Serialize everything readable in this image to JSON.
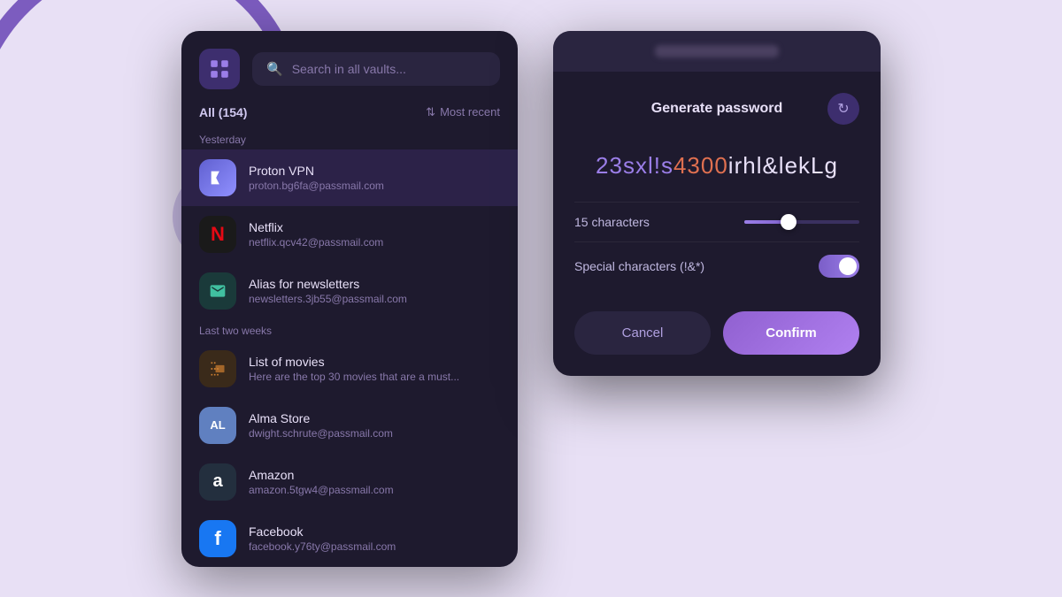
{
  "background": {
    "color": "#e8e0f5"
  },
  "vault_panel": {
    "logo_icon": "grid-icon",
    "search_placeholder": "Search in all vaults...",
    "filter": {
      "label": "All",
      "count": "(154)",
      "sort": "Most recent"
    },
    "sections": [
      {
        "label": "Yesterday",
        "items": [
          {
            "name": "Proton VPN",
            "email": "proton.bg6fa@passmail.com",
            "icon_type": "proton"
          },
          {
            "name": "Netflix",
            "email": "netflix.qcv42@passmail.com",
            "icon_type": "netflix"
          },
          {
            "name": "Alias for newsletters",
            "email": "newsletters.3jb55@passmail.com",
            "icon_type": "alias"
          }
        ]
      },
      {
        "label": "Last two weeks",
        "items": [
          {
            "name": "List of movies",
            "email": "Here are the top 30 movies that are a must...",
            "icon_type": "movies"
          },
          {
            "name": "Alma Store",
            "email": "dwight.schrute@passmail.com",
            "icon_type": "alma",
            "initials": "AL"
          },
          {
            "name": "Amazon",
            "email": "amazon.5tgw4@passmail.com",
            "icon_type": "amazon",
            "symbol": "a"
          },
          {
            "name": "Facebook",
            "email": "facebook.y76ty@passmail.com",
            "icon_type": "facebook",
            "symbol": "f"
          }
        ]
      }
    ]
  },
  "password_panel": {
    "title": "Generate password",
    "generated_password": {
      "part1": "23sxl!s",
      "part2": "4300",
      "part3": "irhl&lekLg"
    },
    "options": {
      "characters_label": "15 characters",
      "characters_value": 15,
      "slider_percent": 45,
      "special_chars_label": "Special characters (!&*)",
      "special_chars_enabled": true
    },
    "buttons": {
      "cancel": "Cancel",
      "confirm": "Confirm"
    },
    "refresh_icon": "refresh-icon"
  }
}
